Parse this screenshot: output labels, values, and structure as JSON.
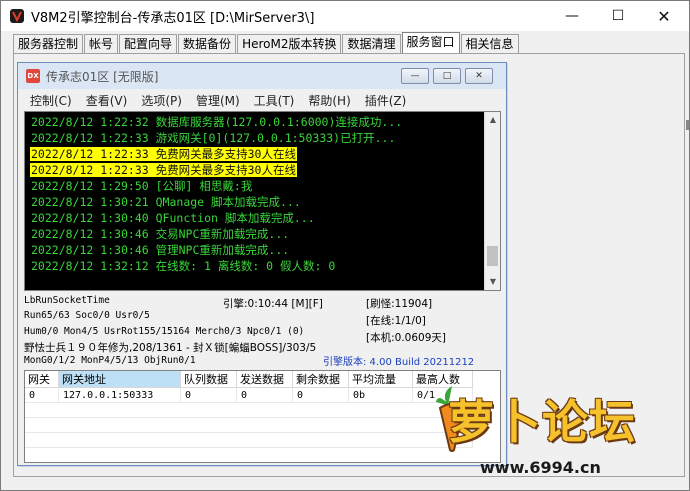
{
  "outer_window": {
    "title": "V8M2引擎控制台-传承志01区 [D:\\MirServer3\\]",
    "min_glyph": "—",
    "max_glyph": "☐",
    "close_glyph": "✕"
  },
  "tabs": [
    {
      "label": "服务器控制"
    },
    {
      "label": "帐号"
    },
    {
      "label": "配置向导"
    },
    {
      "label": "数据备份"
    },
    {
      "label": "HeroM2版本转换"
    },
    {
      "label": "数据清理"
    },
    {
      "label": "服务窗口"
    },
    {
      "label": "相关信息"
    }
  ],
  "active_tab": "服务窗口",
  "inner_window": {
    "icon_text": "DX",
    "title": "传承志01区 [无限版]",
    "min_glyph": "—",
    "max_glyph": "□",
    "close_glyph": "✕"
  },
  "menu": [
    {
      "label": "控制(C)"
    },
    {
      "label": "查看(V)"
    },
    {
      "label": "选项(P)"
    },
    {
      "label": "管理(M)"
    },
    {
      "label": "工具(T)"
    },
    {
      "label": "帮助(H)"
    },
    {
      "label": "插件(Z)"
    }
  ],
  "console": {
    "lines": [
      {
        "text": "2022/8/12 1:22:32 数据库服务器(127.0.0.1:6000)连接成功...",
        "highlight": false
      },
      {
        "text": "2022/8/12 1:22:33 游戏网关[0](127.0.0.1:50333)已打开...",
        "highlight": false
      },
      {
        "text": "2022/8/12 1:22:33 免费网关最多支持30人在线",
        "highlight": true
      },
      {
        "text": "2022/8/12 1:22:33 免费网关最多支持30人在线",
        "highlight": true
      },
      {
        "text": "2022/8/12 1:29:50 [公聊] 相思戴:我",
        "highlight": false
      },
      {
        "text": "2022/8/12 1:30:21 QManage 脚本加载完成...",
        "highlight": false
      },
      {
        "text": "2022/8/12 1:30:40 QFunction 脚本加载完成...",
        "highlight": false
      },
      {
        "text": "2022/8/12 1:30:46 交易NPC重新加载完成...",
        "highlight": false
      },
      {
        "text": "2022/8/12 1:30:46 管理NPC重新加载完成...",
        "highlight": false
      },
      {
        "text": "2022/8/12 1:32:12 在线数: 1 离线数: 0 假人数: 0",
        "highlight": false
      }
    ],
    "scroll_up": "▲",
    "scroll_down": "▼"
  },
  "stats": {
    "socket_time": "LbRunSocketTime",
    "engine_time": "引擎:0:10:44 [M][F]",
    "refresh": "[刷怪:11904]",
    "run": "Run65/63 Soc0/0 Usr0/5",
    "online": "[在线:1/1/0]",
    "hum": "Hum0/0 Mon4/5 UsrRot155/15164 Merch0/3 Npc0/1 (0)",
    "local": "[本机:0.0609天]",
    "monster": "野怯士兵１９０年修为,208/1361 - 封Ｘ锁[蝙蝠BOSS]/303/5",
    "mongen": "MonG0/1/2 MonP4/5/13 ObjRun0/1",
    "version": "引擎版本: 4.00 Build 20211212"
  },
  "gateway_table": {
    "columns": [
      "网关",
      "网关地址",
      "队列数据",
      "发送数据",
      "剩余数据",
      "平均流量",
      "最高人数"
    ],
    "rows": [
      [
        "0",
        "127.0.0.1:50333",
        "0",
        "0",
        "0",
        "0b",
        "0/1"
      ]
    ]
  },
  "watermark": {
    "text": "萝卜论坛",
    "url": "www.6994.cn"
  },
  "colors": {
    "console_bg": "#000000",
    "console_text": "#39d639",
    "highlight_bg": "#ffff00",
    "version_text": "#1a3fbf",
    "watermark_yellow": "#f5c22b"
  }
}
